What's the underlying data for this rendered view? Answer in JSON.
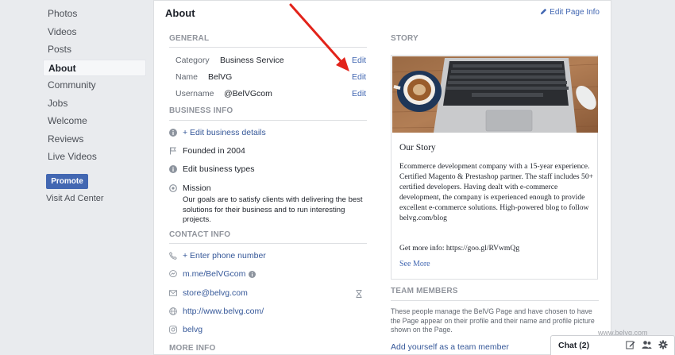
{
  "leftnav": {
    "items": [
      {
        "label": "Photos"
      },
      {
        "label": "Videos"
      },
      {
        "label": "Posts"
      },
      {
        "label": "About"
      },
      {
        "label": "Community"
      },
      {
        "label": "Jobs"
      },
      {
        "label": "Welcome"
      },
      {
        "label": "Reviews"
      },
      {
        "label": "Live Videos"
      }
    ],
    "active": "About",
    "promote_label": "Promote",
    "ad_center_label": "Visit Ad Center"
  },
  "main": {
    "title": "About",
    "edit_page_info": "Edit Page Info",
    "general": {
      "label": "GENERAL",
      "rows": [
        {
          "key": "Category",
          "value": "Business Service",
          "action": "Edit"
        },
        {
          "key": "Name",
          "value": "BelVG",
          "action": "Edit"
        },
        {
          "key": "Username",
          "value": "@BelVGcom",
          "action": "Edit"
        }
      ]
    },
    "business_info": {
      "label": "BUSINESS INFO",
      "edit_details": "+ Edit business details",
      "founded": "Founded in 2004",
      "edit_types": "Edit business types",
      "mission_label": "Mission",
      "mission_text": "Our goals are to satisfy clients with delivering the best solutions for their business and to run interesting projects."
    },
    "contact_info": {
      "label": "CONTACT INFO",
      "phone": "+ Enter phone number",
      "messenger": "m.me/BelVGcom",
      "email": "store@belvg.com",
      "website": "http://www.belvg.com/",
      "instagram": "belvg"
    },
    "more_info": {
      "label": "MORE INFO"
    },
    "story": {
      "label": "STORY",
      "title": "Our Story",
      "body": "Ecommerce development company with a 15-year experience. Certified Magento & Prestashop partner. The staff includes 50+ certified developers. Having dealt with e-commerce development, the company is experienced enough to provide excellent e-commerce solutions. High-powered blog to follow belvg.com/blog",
      "more_info": "Get more info: https://goo.gl/RVwmQg",
      "see_more": "See More"
    },
    "team": {
      "label": "TEAM MEMBERS",
      "text": "These people manage the BelVG Page and have chosen to have the Page appear on their profile and their name and profile picture shown on the Page.",
      "add_label": "Add yourself as a team member"
    }
  },
  "chat": {
    "label": "Chat (2)"
  },
  "watermark": "www.belvg.com",
  "colors": {
    "link": "#4267b2",
    "arrow": "#e2231a",
    "background": "#e9ebee"
  }
}
